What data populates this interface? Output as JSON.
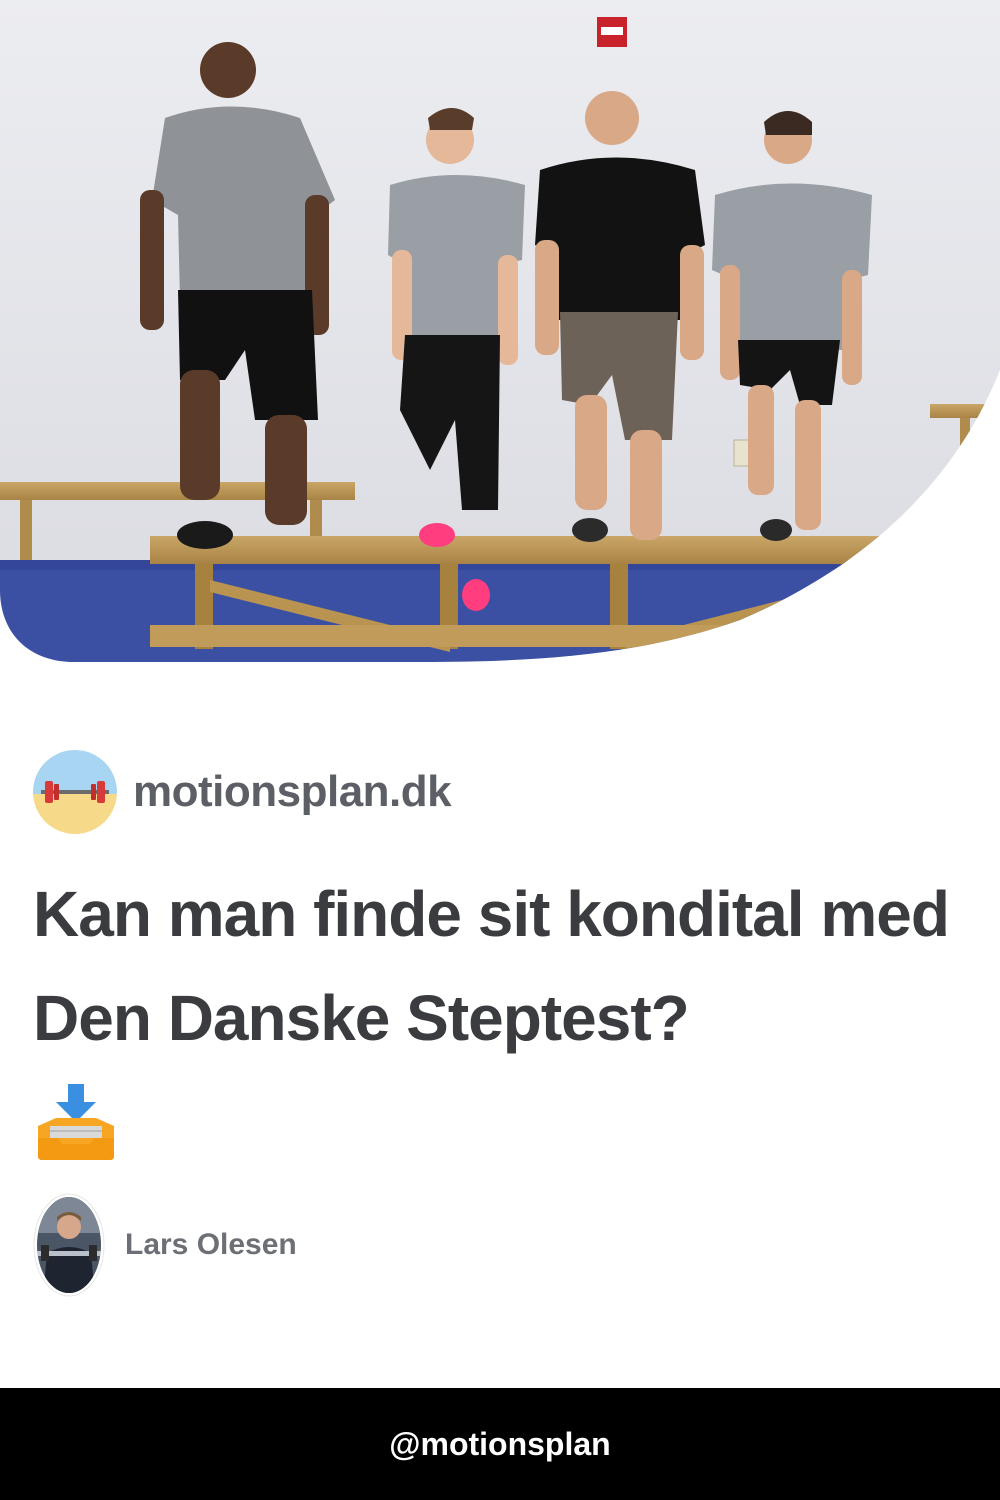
{
  "hero": {
    "image": "photo-four-people-step-test-on-wooden-bench"
  },
  "site": {
    "logo_icon": "barbell-icon",
    "name": "motionsplan.dk"
  },
  "article": {
    "title": "Kan man finde sit kondital med Den Danske Steptest?",
    "icon": "inbox-tray-download-icon"
  },
  "author": {
    "avatar": "author-photo",
    "name": "Lars Olesen"
  },
  "footer": {
    "handle": "@motionsplan"
  },
  "colors": {
    "background": "#ffffff",
    "title": "#3a3c40",
    "site_name": "#5c6066",
    "author_name": "#6c7076",
    "footer_bg": "#000000",
    "footer_text": "#ffffff"
  }
}
